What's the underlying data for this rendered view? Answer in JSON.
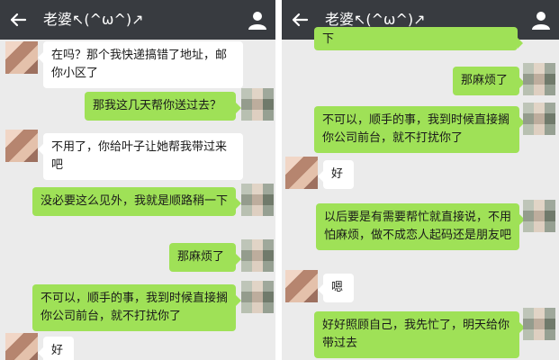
{
  "left": {
    "header": {
      "title": "老婆↖(^ω^)↗",
      "back_icon": "back-arrow-icon",
      "profile_icon": "person-icon"
    },
    "messages": [
      {
        "from": "other",
        "text": "在吗？那个我快递搞错了地址，邮你小区了"
      },
      {
        "from": "self",
        "text": "那我这几天帮你送过去？"
      },
      {
        "from": "other",
        "text": "不用了，你给叶子让她帮我带过来吧"
      },
      {
        "from": "self",
        "text": "没必要这么见外，我就是顺路稍一下"
      },
      {
        "from": "self",
        "text": "那麻烦了"
      },
      {
        "from": "self",
        "text": "不可以，顺手的事，我到时候直接搁你公司前台，就不打扰你了"
      },
      {
        "from": "other",
        "text": "好"
      }
    ]
  },
  "right": {
    "header": {
      "title": "老婆↖(^ω^)↗",
      "back_icon": "back-arrow-icon",
      "profile_icon": "person-icon"
    },
    "messages": [
      {
        "from": "self",
        "text": "下"
      },
      {
        "from": "self",
        "text": "那麻烦了"
      },
      {
        "from": "self",
        "text": "不可以，顺手的事，我到时候直接搁你公司前台，就不打扰你了"
      },
      {
        "from": "other",
        "text": "好"
      },
      {
        "from": "self",
        "text": "以后要是有需要帮忙就直接说，不用怕麻烦，做不成恋人起码还是朋友吧"
      },
      {
        "from": "other",
        "text": "嗯"
      },
      {
        "from": "self",
        "text": "好好照顾自己，我先忙了，明天给你带过去"
      }
    ]
  }
}
